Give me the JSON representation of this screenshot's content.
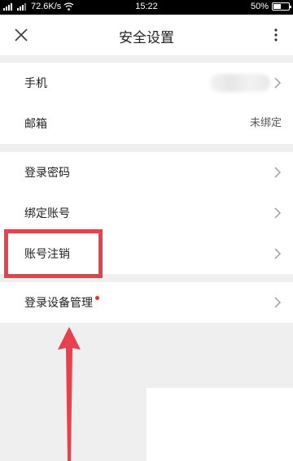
{
  "status_bar": {
    "network": "72.6K/s",
    "time": "15:22",
    "battery": "50%",
    "battery_level": 0.5
  },
  "header": {
    "title": "安全设置"
  },
  "section1": {
    "phone_label": "手机",
    "email_label": "邮箱",
    "email_value": "未绑定"
  },
  "section2": {
    "password_label": "登录密码",
    "bind_label": "绑定账号",
    "cancel_label": "账号注销"
  },
  "section3": {
    "device_label": "登录设备管理"
  },
  "colors": {
    "accent_red": "#e8404c",
    "dot_red": "#e8312f"
  }
}
